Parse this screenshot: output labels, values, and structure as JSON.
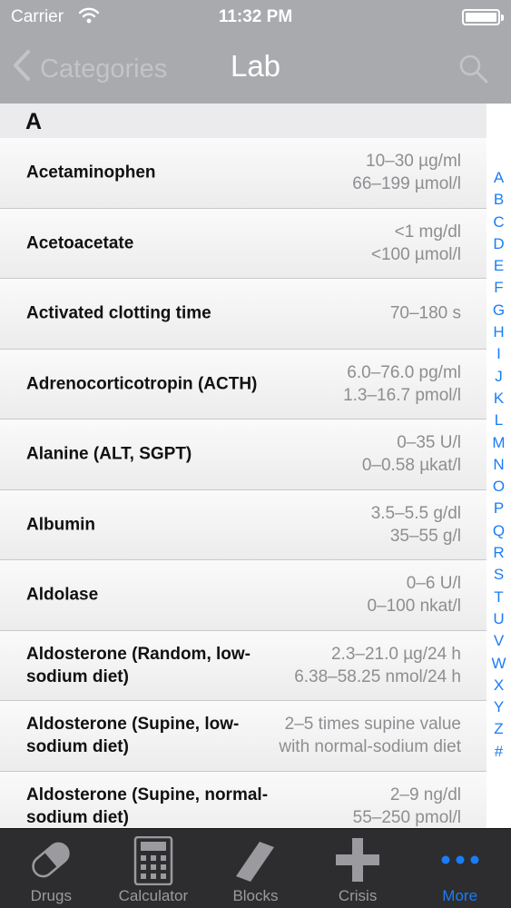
{
  "status_bar": {
    "carrier": "Carrier",
    "time": "11:32 PM"
  },
  "nav": {
    "back_label": "Categories",
    "title": "Lab"
  },
  "section": {
    "header": "A"
  },
  "rows": [
    {
      "name": "Acetaminophen",
      "values": [
        "10–30 µg/ml",
        "66–199 µmol/l"
      ]
    },
    {
      "name": "Acetoacetate",
      "values": [
        "<1 mg/dl",
        "<100 µmol/l"
      ]
    },
    {
      "name": "Activated clotting time",
      "values": [
        "70–180 s"
      ]
    },
    {
      "name": "Adrenocorticotropin (ACTH)",
      "values": [
        "6.0–76.0 pg/ml",
        "1.3–16.7 pmol/l"
      ]
    },
    {
      "name": "Alanine (ALT, SGPT)",
      "values": [
        "0–35 U/l",
        "0–0.58 µkat/l"
      ]
    },
    {
      "name": "Albumin",
      "values": [
        "3.5–5.5 g/dl",
        "35–55 g/l"
      ]
    },
    {
      "name": "Aldolase",
      "values": [
        "0–6 U/l",
        "0–100 nkat/l"
      ]
    },
    {
      "name": "Aldosterone (Random, low-sodium diet)",
      "values": [
        "2.3–21.0 µg/24 h",
        "6.38–58.25 nmol/24 h"
      ]
    },
    {
      "name": "Aldosterone (Supine, low-sodium diet)",
      "values": [
        "2–5 times supine value",
        "with normal-sodium diet"
      ]
    },
    {
      "name": "Aldosterone (Supine, normal-sodium diet)",
      "values": [
        "2–9 ng/dl",
        "55–250 pmol/l"
      ]
    }
  ],
  "index_letters": [
    "A",
    "B",
    "C",
    "D",
    "E",
    "F",
    "G",
    "H",
    "I",
    "J",
    "K",
    "L",
    "M",
    "N",
    "O",
    "P",
    "Q",
    "R",
    "S",
    "T",
    "U",
    "V",
    "W",
    "X",
    "Y",
    "Z",
    "#"
  ],
  "tabs": [
    {
      "label": "Drugs",
      "icon": "pill-icon"
    },
    {
      "label": "Calculator",
      "icon": "calculator-icon"
    },
    {
      "label": "Blocks",
      "icon": "blocks-icon"
    },
    {
      "label": "Crisis",
      "icon": "cross-icon"
    },
    {
      "label": "More",
      "icon": "more-icon",
      "active": true
    }
  ],
  "colors": {
    "accent": "#1a7df5",
    "bar": "#a9aaad",
    "tabbar": "#2d2d2f"
  }
}
